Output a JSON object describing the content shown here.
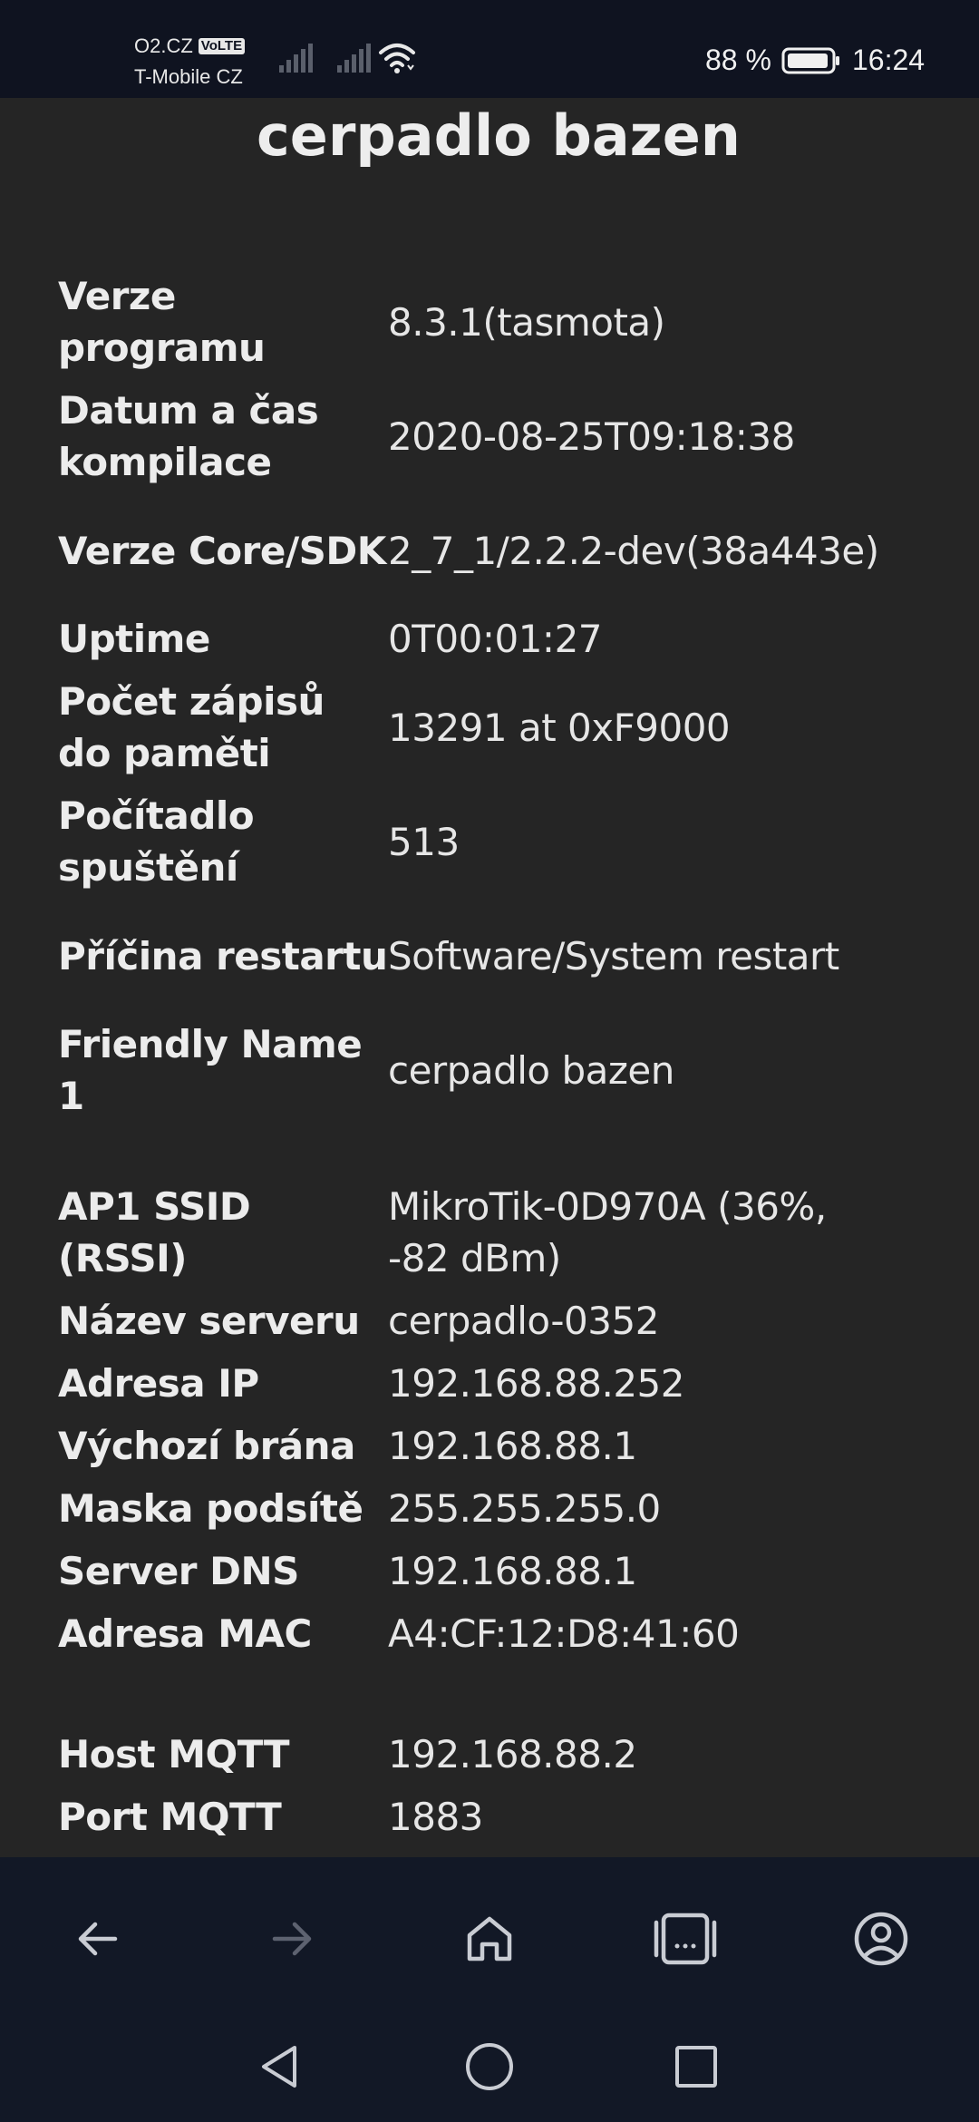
{
  "status_bar": {
    "carrier_primary": "O2.CZ",
    "volte_badge": "VoLTE",
    "carrier_secondary": "T-Mobile CZ",
    "battery": "88 %",
    "time": "16:24",
    "icons": [
      "signal-icon",
      "signal-icon",
      "wifi-icon",
      "battery-icon"
    ]
  },
  "page": {
    "title": "cerpadlo bazen"
  },
  "info": {
    "rows": [
      {
        "label": "Verze programu",
        "value": "8.3.1(tasmota)"
      },
      {
        "label": "Datum a čas kompilace",
        "value": "2020-08-25T09:18:38"
      },
      {
        "label": "Verze Core/SDK",
        "value": "2_7_1/2.2.2-dev(38a443e)"
      },
      {
        "label": "Uptime",
        "value": "0T00:01:27"
      },
      {
        "label": "Počet zápisů do paměti",
        "value": "13291 at 0xF9000"
      },
      {
        "label": "Počítadlo spuštění",
        "value": "513"
      },
      {
        "label": "Příčina restartu",
        "value": "Software/System restart"
      },
      {
        "label": "Friendly Name 1",
        "value": "cerpadlo bazen"
      },
      {
        "label": "AP1 SSID (RSSI)",
        "value": "MikroTik-0D970A (36%, -82 dBm)"
      },
      {
        "label": "Název serveru",
        "value": "cerpadlo-0352"
      },
      {
        "label": "Adresa IP",
        "value": "192.168.88.252"
      },
      {
        "label": "Výchozí brána",
        "value": "192.168.88.1"
      },
      {
        "label": "Maska podsítě",
        "value": "255.255.255.0"
      },
      {
        "label": "Server DNS",
        "value": "192.168.88.1"
      },
      {
        "label": "Adresa MAC",
        "value": "A4:CF:12:D8:41:60"
      },
      {
        "label": "Host MQTT",
        "value": "192.168.88.2"
      },
      {
        "label": "Port MQTT",
        "value": "1883"
      }
    ]
  },
  "browser_toolbar": {
    "icons": [
      "back-arrow-icon",
      "forward-arrow-icon",
      "home-icon",
      "tabs-icon",
      "profile-icon"
    ]
  },
  "system_nav": {
    "icons": [
      "nav-back-icon",
      "nav-home-icon",
      "nav-recents-icon"
    ]
  },
  "colors": {
    "background": "#252525",
    "status_bar": "#0f1320",
    "toolbar": "#121826",
    "text": "#eaeaea",
    "icon": "#c9ccd3",
    "icon_disabled": "#5d6270"
  }
}
